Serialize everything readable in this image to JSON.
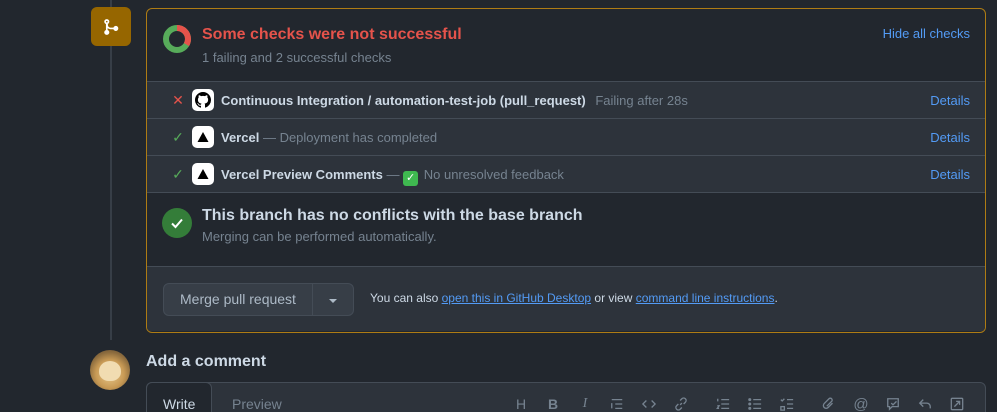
{
  "status": {
    "title": "Some checks were not successful",
    "subtitle": "1 failing and 2 successful checks",
    "hide_label": "Hide all checks"
  },
  "checks": [
    {
      "state": "fail",
      "state_icon": "x-icon",
      "app_icon": "github-icon",
      "name": "Continuous Integration / automation-test-job (pull_request)",
      "description": "Failing after 28s",
      "details_label": "Details"
    },
    {
      "state": "pass",
      "state_icon": "check-icon",
      "app_icon": "vercel-icon",
      "name": "Vercel",
      "description": "— Deployment has completed",
      "details_label": "Details"
    },
    {
      "state": "pass",
      "state_icon": "check-icon",
      "app_icon": "vercel-icon",
      "name": "Vercel Preview Comments",
      "description_prefix": "—",
      "emoji": "✓",
      "description": "No unresolved feedback",
      "details_label": "Details"
    }
  ],
  "branch": {
    "title": "This branch has no conflicts with the base branch",
    "subtitle": "Merging can be performed automatically."
  },
  "merge": {
    "button_label": "Merge pull request",
    "footer_prefix": "You can also",
    "desktop_link": "open this in GitHub Desktop",
    "footer_middle": "or view",
    "cli_link": "command line instructions",
    "footer_suffix": "."
  },
  "comment": {
    "heading": "Add a comment",
    "tab_write": "Write",
    "tab_preview": "Preview",
    "toolbar_icons": [
      "heading-icon",
      "bold-icon",
      "italic-icon",
      "quote-icon",
      "code-icon",
      "link-icon",
      "ordered-list-icon",
      "unordered-list-icon",
      "task-list-icon",
      "attach-icon",
      "mention-icon",
      "reference-icon",
      "reply-icon",
      "fullscreen-icon"
    ]
  },
  "colors": {
    "fail": "#e5534b",
    "success": "#57ab5a",
    "link": "#539bf5",
    "warning_border": "#ae7c14"
  }
}
